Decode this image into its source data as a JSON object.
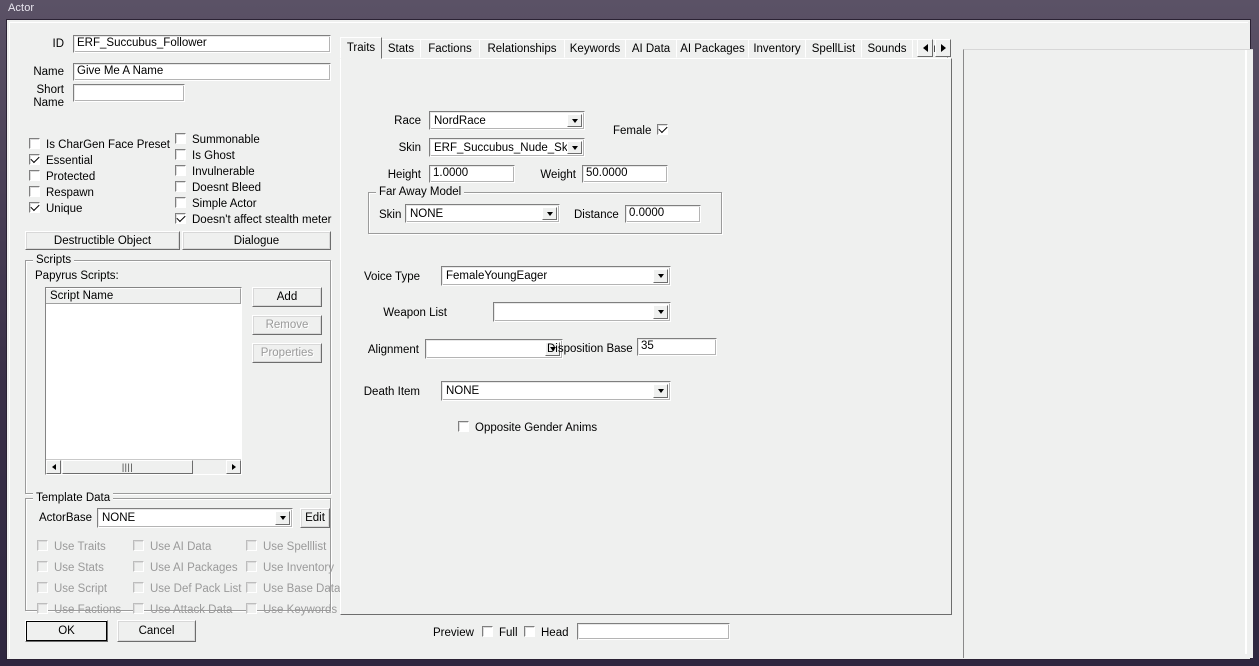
{
  "window": {
    "title": "Actor"
  },
  "identity": {
    "id_label": "ID",
    "id_value": "ERF_Succubus_Follower",
    "name_label": "Name",
    "name_value": "Give Me A Name",
    "short_name_label_line1": "Short",
    "short_name_label_line2": "Name",
    "short_name_value": ""
  },
  "flags_left": [
    {
      "label": "Is CharGen Face Preset",
      "checked": false
    },
    {
      "label": "Essential",
      "checked": true
    },
    {
      "label": "Protected",
      "checked": false
    },
    {
      "label": "Respawn",
      "checked": false
    },
    {
      "label": "Unique",
      "checked": true
    }
  ],
  "flags_right": [
    {
      "label": "Summonable",
      "checked": false
    },
    {
      "label": "Is Ghost",
      "checked": false
    },
    {
      "label": "Invulnerable",
      "checked": false
    },
    {
      "label": "Doesnt Bleed",
      "checked": false
    },
    {
      "label": "Simple Actor",
      "checked": false
    },
    {
      "label": "Doesn't affect stealth meter",
      "checked": true
    }
  ],
  "buttons": {
    "destructible_object": "Destructible Object",
    "dialogue": "Dialogue",
    "add": "Add",
    "remove": "Remove",
    "properties": "Properties",
    "edit": "Edit",
    "ok": "OK",
    "cancel": "Cancel"
  },
  "scripts": {
    "group_title": "Scripts",
    "caption": "Papyrus Scripts:",
    "column_header": "Script Name",
    "rows": [],
    "scroll_thumb_glyph": "||||"
  },
  "template_data": {
    "group_title": "Template Data",
    "actorbase_label": "ActorBase",
    "actorbase_value": "NONE",
    "checkboxes": [
      {
        "label": "Use Traits",
        "checked": false,
        "disabled": true
      },
      {
        "label": "Use AI Data",
        "checked": false,
        "disabled": true
      },
      {
        "label": "Use Spelllist",
        "checked": false,
        "disabled": true
      },
      {
        "label": "Use Stats",
        "checked": false,
        "disabled": true
      },
      {
        "label": "Use AI Packages",
        "checked": false,
        "disabled": true
      },
      {
        "label": "Use Inventory",
        "checked": false,
        "disabled": true
      },
      {
        "label": "Use Script",
        "checked": false,
        "disabled": true
      },
      {
        "label": "Use Def Pack List",
        "checked": false,
        "disabled": true
      },
      {
        "label": "Use Base Data",
        "checked": false,
        "disabled": true
      },
      {
        "label": "Use Factions",
        "checked": false,
        "disabled": true
      },
      {
        "label": "Use Attack Data",
        "checked": false,
        "disabled": true
      },
      {
        "label": "Use Keywords",
        "checked": false,
        "disabled": true
      }
    ]
  },
  "tabs": {
    "items": [
      {
        "label": "Traits",
        "selected": true
      },
      {
        "label": "Stats",
        "selected": false
      },
      {
        "label": "Factions",
        "selected": false
      },
      {
        "label": "Relationships",
        "selected": false
      },
      {
        "label": "Keywords",
        "selected": false
      },
      {
        "label": "AI Data",
        "selected": false
      },
      {
        "label": "AI Packages",
        "selected": false
      },
      {
        "label": "Inventory",
        "selected": false
      },
      {
        "label": "SpellList",
        "selected": false
      },
      {
        "label": "Sounds",
        "selected": false
      },
      {
        "label": "Anim",
        "selected": false
      }
    ],
    "scroll_left": "◄",
    "scroll_right": "►"
  },
  "traits": {
    "race_label": "Race",
    "race_value": "NordRace",
    "female_label": "Female",
    "female_checked": true,
    "skin_label": "Skin",
    "skin_value": "ERF_Succubus_Nude_Skin",
    "height_label": "Height",
    "height_value": "1.0000",
    "weight_label": "Weight",
    "weight_value": "50.0000",
    "far_away_model": {
      "group_title": "Far Away Model",
      "skin_label": "Skin",
      "skin_value": "NONE",
      "distance_label": "Distance",
      "distance_value": "0.0000"
    },
    "voice_type_label": "Voice Type",
    "voice_type_value": "FemaleYoungEager",
    "weapon_list_label": "Weapon List",
    "weapon_list_value": "",
    "alignment_label": "Alignment",
    "alignment_value": "",
    "disposition_base_label": "Disposition Base",
    "disposition_base_value": "35",
    "death_item_label": "Death Item",
    "death_item_value": "NONE",
    "opposite_gender_anims_label": "Opposite Gender Anims",
    "opposite_gender_anims_checked": false
  },
  "preview": {
    "label": "Preview",
    "full_label": "Full",
    "full_checked": false,
    "head_label": "Head",
    "head_checked": false,
    "field_value": ""
  },
  "colors": {
    "face": "#eff0ef",
    "field": "#ffffff",
    "border_dark": "#6d6d6d",
    "title_bar": "#3b3149",
    "disabled_text": "#9a9a9a"
  }
}
